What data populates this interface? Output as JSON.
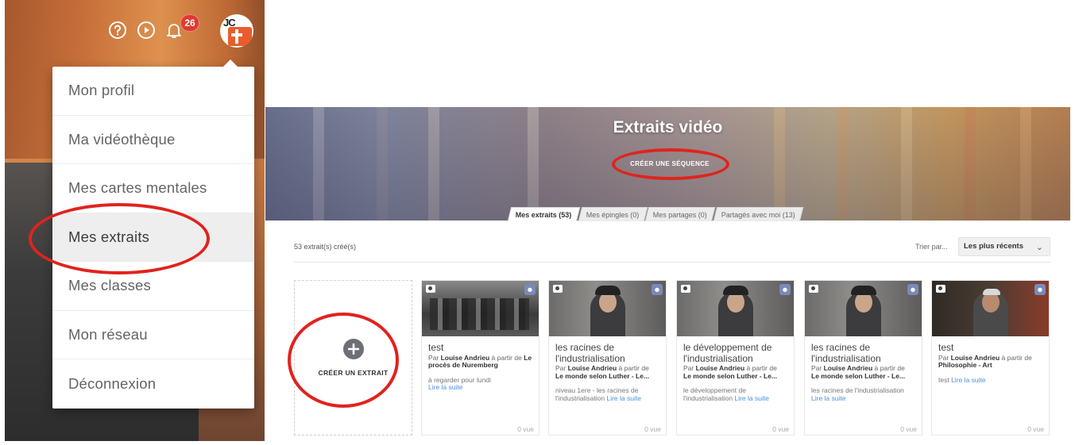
{
  "header": {
    "help_icon": "help-icon",
    "play_icon": "play-icon",
    "notifications_icon": "bell-icon",
    "notifications_count": "26",
    "avatar_initials": "JC"
  },
  "menu": {
    "items": [
      {
        "label": "Mon profil"
      },
      {
        "label": "Ma vidéothèque"
      },
      {
        "label": "Mes cartes mentales"
      },
      {
        "label": "Mes extraits"
      },
      {
        "label": "Mes classes"
      },
      {
        "label": "Mon réseau"
      },
      {
        "label": "Déconnexion"
      }
    ]
  },
  "hero": {
    "title": "Extraits vidéo",
    "button": "CRÉER UNE SÉQUENCE"
  },
  "tabs": [
    {
      "label": "Mes extraits (53)"
    },
    {
      "label": "Mes épingles (0)"
    },
    {
      "label": "Mes partages (0)"
    },
    {
      "label": "Partagés avec moi (13)"
    }
  ],
  "list": {
    "count": "53 extrait(s) créé(s)",
    "sort_label": "Trier par...",
    "sort_value": "Les plus récents",
    "create_label": "CRÉER UN EXTRAIT"
  },
  "cards": [
    {
      "title": "test",
      "by": "Par",
      "author": "Louise Andrieu",
      "from": "à partir de",
      "source": "Le procès de Nuremberg",
      "desc": "à regarder pour lundi",
      "more": "Lire la suite",
      "views": "0 vue"
    },
    {
      "title": "les racines de l'industrialisation",
      "by": "Par",
      "author": "Louise Andrieu",
      "from": "à partir de",
      "source": "Le monde selon Luther - Le...",
      "desc": "niveau 1ere - les racines de l'industrialisation",
      "more": "Lire la suite",
      "views": "0 vue"
    },
    {
      "title": "le développement de l'industrialisation",
      "by": "Par",
      "author": "Louise Andrieu",
      "from": "à partir de",
      "source": "Le monde selon Luther - Le...",
      "desc": "le développement de l'industrialisation",
      "more": "Lire la suite",
      "views": "0 vue"
    },
    {
      "title": "les racines de l'industrialisation",
      "by": "Par",
      "author": "Louise Andrieu",
      "from": "à partir de",
      "source": "Le monde selon Luther - Le...",
      "desc": "les racines de l'industrialisation",
      "more": "Lire la suite",
      "views": "0 vue"
    },
    {
      "title": "test",
      "by": "Par",
      "author": "Louise Andrieu",
      "from": "à partir de",
      "source": "Philosophie - Art",
      "desc": "test",
      "more": "Lire la suite",
      "views": "0 vue"
    }
  ],
  "colors": {
    "accent_link": "#4a90d9",
    "annotation_red": "#e0231d",
    "badge_red": "#e0392f"
  }
}
